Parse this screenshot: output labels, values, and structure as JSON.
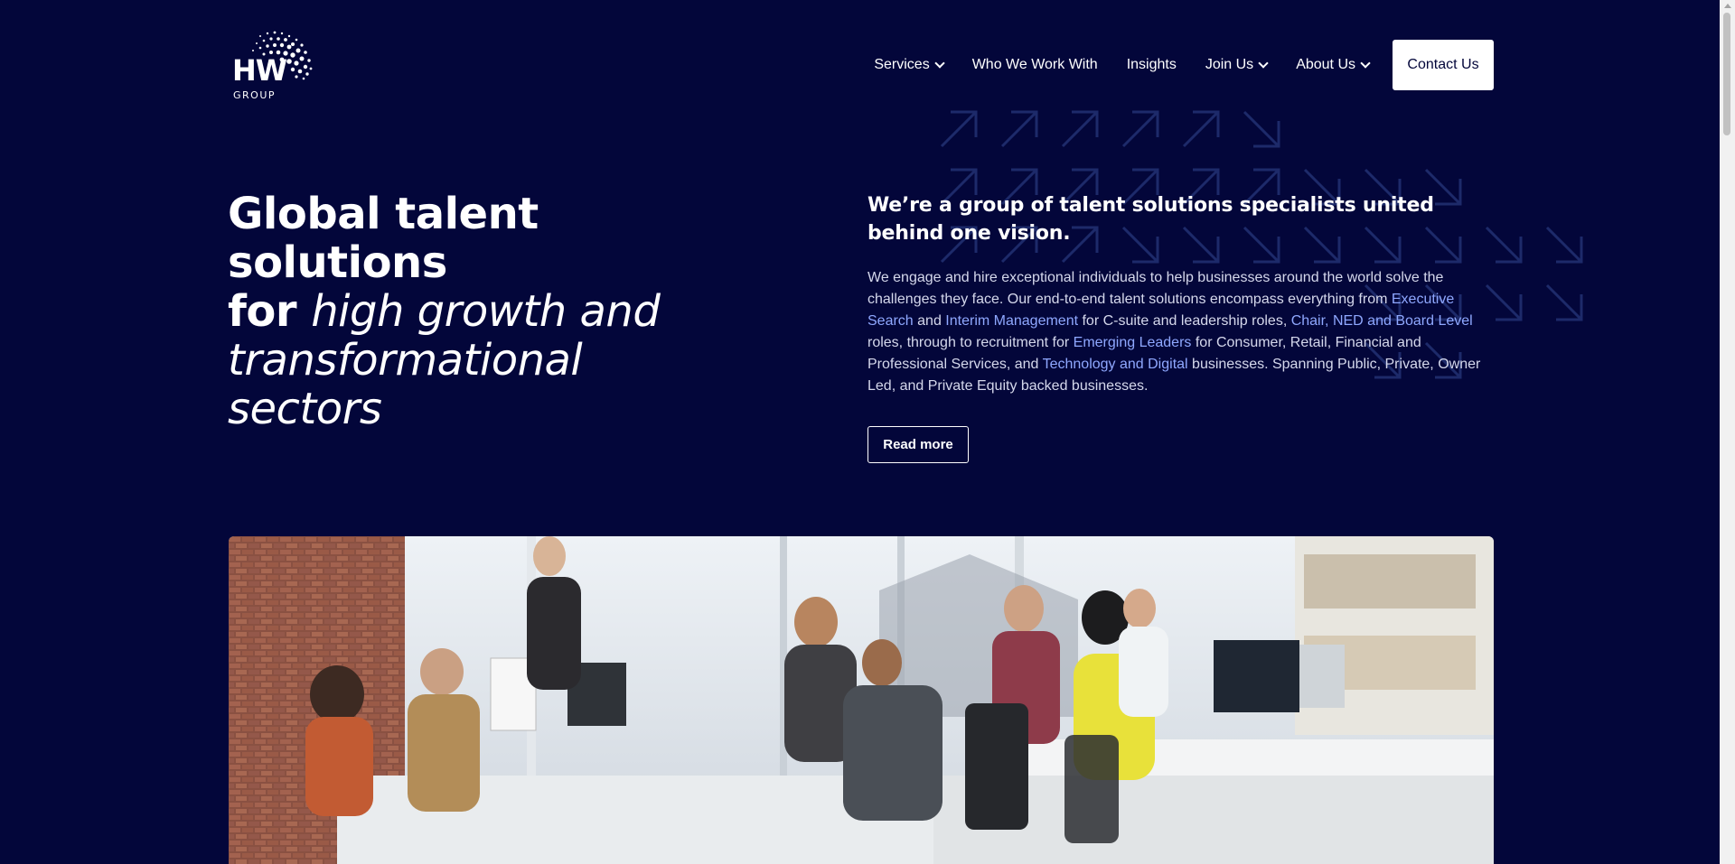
{
  "brand": {
    "logo_text": "HW",
    "logo_subtext": "GROUP",
    "logo_icon": "globe-dots-icon"
  },
  "nav": {
    "items": [
      {
        "label": "Services",
        "has_dropdown": true
      },
      {
        "label": "Who We Work With",
        "has_dropdown": false
      },
      {
        "label": "Insights",
        "has_dropdown": false
      },
      {
        "label": "Join Us",
        "has_dropdown": true
      },
      {
        "label": "About Us",
        "has_dropdown": true
      }
    ],
    "contact_label": "Contact Us"
  },
  "hero": {
    "title_line1": "Global talent solutions",
    "title_for": "for",
    "title_italic_1": "high growth and",
    "title_italic_2": "transformational sectors"
  },
  "intro": {
    "heading": "We’re a group of talent solutions specialists united behind one vision.",
    "body_1": "We engage and hire exceptional individuals to help businesses around the world solve the challenges they face. Our end-to-end talent solutions encompass everything from ",
    "link_1": "Executive Search",
    "body_2": " and ",
    "link_2": "Interim Management",
    "body_3": " for C-suite and leadership roles, ",
    "link_3": "Chair, NED and Board Level",
    "body_4": " roles, through to recruitment for ",
    "link_4": "Emerging Leaders",
    "body_5": " for Consumer, Retail, Financial and Professional Services, and ",
    "link_5": "Technology and Digital",
    "body_6": "  businesses. Spanning Public, Private, Owner Led, and Private Equity backed businesses.",
    "read_more": "Read more"
  },
  "colors": {
    "background": "#03063a",
    "link": "#8fa8ff",
    "arrow_pattern": "#1d2a6a",
    "text_muted": "#d5d8ec"
  }
}
